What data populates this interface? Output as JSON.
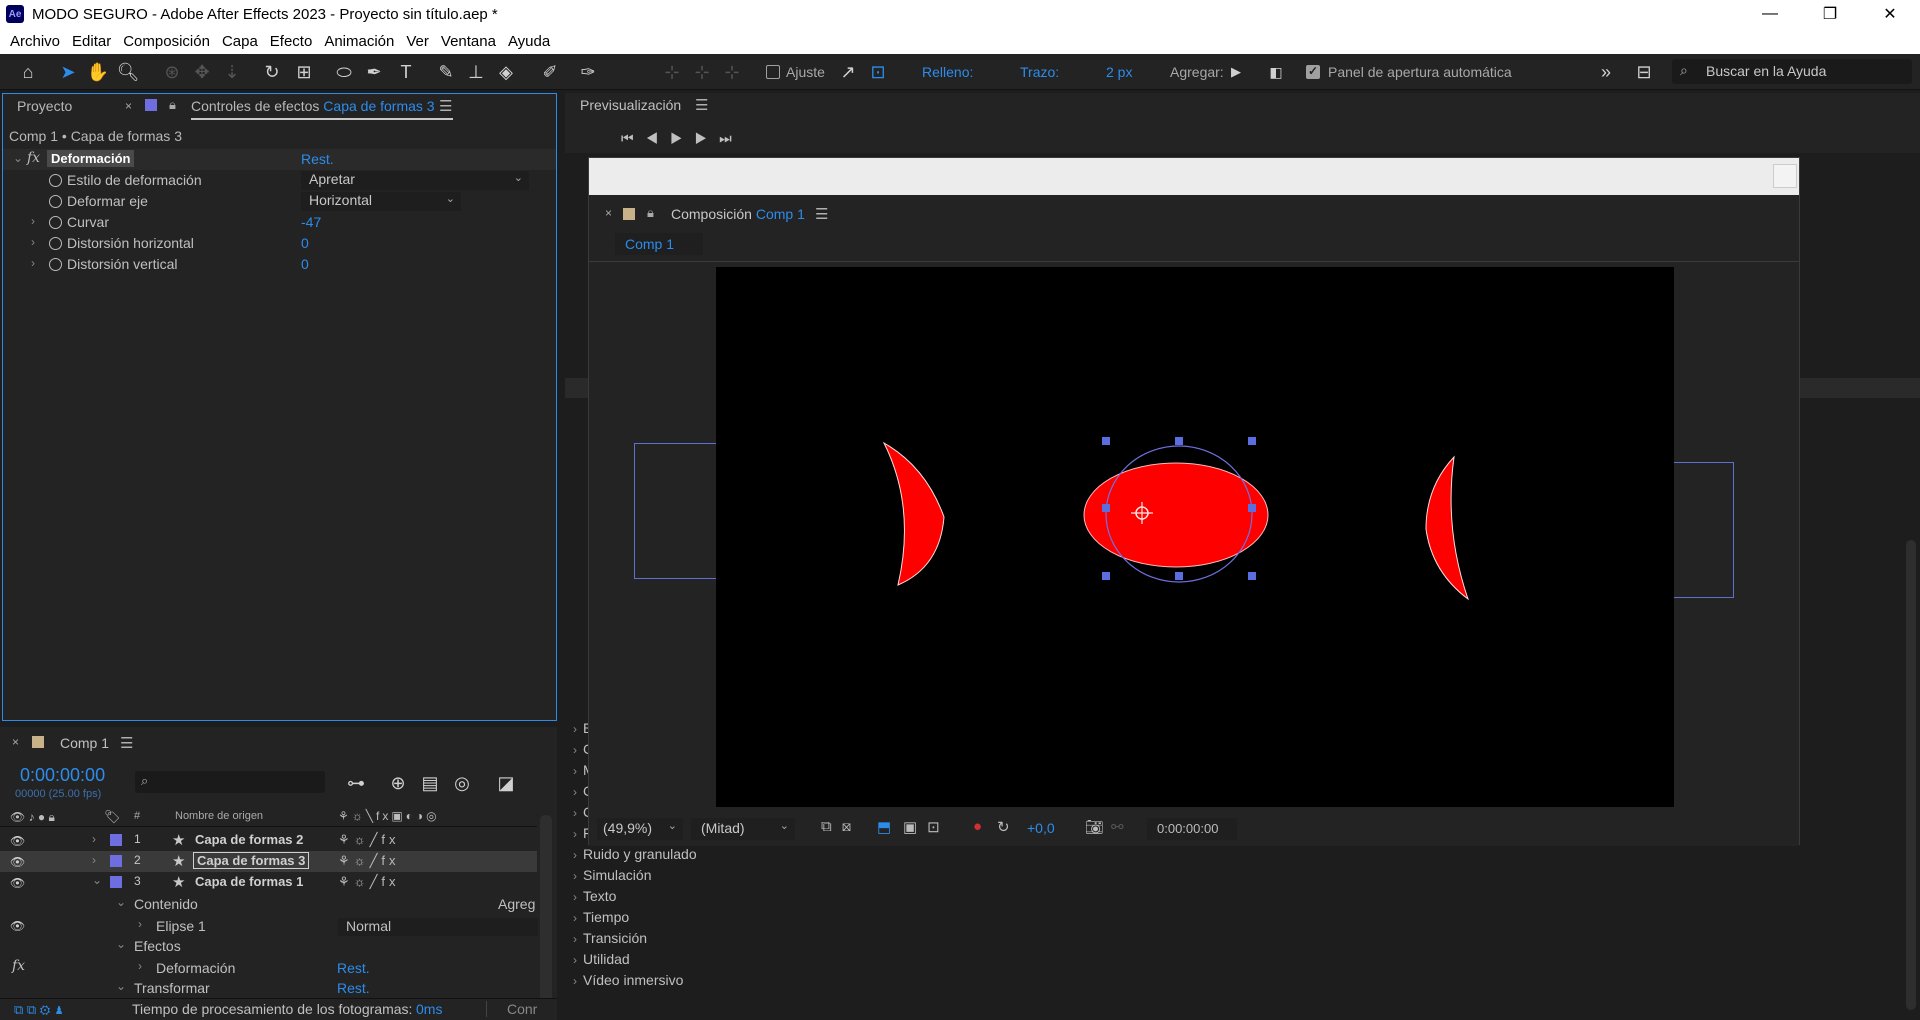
{
  "window": {
    "app_icon": "Ae",
    "title": "MODO SEGURO - Adobe After Effects 2023 - Proyecto sin título.aep *",
    "minimize_icon": "minimize-icon",
    "maximize_icon": "restore-icon",
    "close_icon": "close-icon"
  },
  "menu": [
    "Archivo",
    "Editar",
    "Composición",
    "Capa",
    "Efecto",
    "Animación",
    "Ver",
    "Ventana",
    "Ayuda"
  ],
  "toolbar": {
    "ajuste": "Ajuste",
    "relleno": "Relleno:",
    "relleno_color": "#ff0000",
    "trazo": "Trazo:",
    "trazo_color": "#000000",
    "stroke_width": "2 px",
    "agregar": "Agregar:",
    "panel_apertura": "Panel de apertura automática",
    "search_placeholder": "Buscar en la Ayuda"
  },
  "effect_controls": {
    "tab_project": "Proyecto",
    "tab_effect": "Controles de efectos",
    "tab_effect_layer": "Capa de formas 3",
    "breadcrumb": "Comp 1 • Capa de formas 3",
    "effect_name": "Deformación",
    "reset": "Rest.",
    "properties": [
      {
        "label": "Estilo de deformación",
        "value": "Apretar",
        "type": "dropdown"
      },
      {
        "label": "Deformar eje",
        "value": "Horizontal",
        "type": "dropdown"
      },
      {
        "label": "Curvar",
        "value": "-47",
        "type": "number"
      },
      {
        "label": "Distorsión horizontal",
        "value": "0",
        "type": "number"
      },
      {
        "label": "Distorsión vertical",
        "value": "0",
        "type": "number"
      }
    ]
  },
  "preview": {
    "title": "Previsualización"
  },
  "composition": {
    "panel_label": "Composición",
    "comp_name": "Comp 1",
    "tab": "Comp 1",
    "zoom": "(49,9%)",
    "resolution": "(Mitad)",
    "exposure": "+0,0",
    "timecode": "0:00:00:00",
    "shape_fill": "#ff0000"
  },
  "timeline": {
    "comp_tab": "Comp 1",
    "timecode": "0:00:00:00",
    "frames": "00000 (25.00 fps)",
    "col_num": "#",
    "col_name": "Nombre de origen",
    "layers": [
      {
        "num": "1",
        "name": "Capa de formas 2"
      },
      {
        "num": "2",
        "name": "Capa de formas 3"
      },
      {
        "num": "3",
        "name": "Capa de formas 1"
      }
    ],
    "contenido": "Contenido",
    "agregar": "Agreg",
    "elipse": "Elipse 1",
    "blend_mode": "Normal",
    "efectos": "Efectos",
    "deformacion": "Deformación",
    "reset": "Rest.",
    "transformar": "Transformar",
    "reset2": "Rest."
  },
  "status": {
    "render_time_label": "Tiempo de procesamiento de los fotogramas:",
    "render_time_value": "0ms",
    "toggle": "Conr"
  },
  "effects_list": [
    "Ruido y granulado",
    "Simulación",
    "Texto",
    "Tiempo",
    "Transición",
    "Utilidad",
    "Vídeo inmersivo"
  ]
}
